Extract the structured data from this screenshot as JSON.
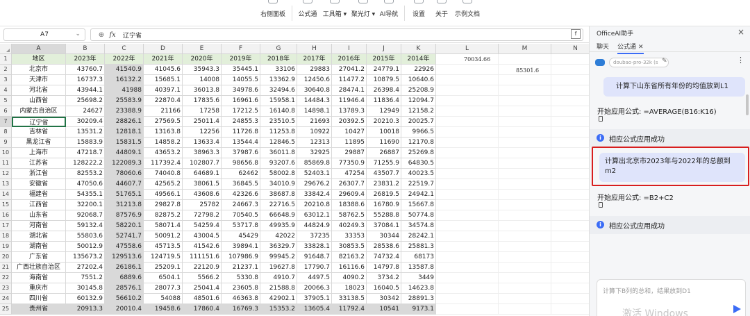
{
  "ribbon": {
    "groups": [
      {
        "label": "右侧面板"
      },
      {
        "label": "公式通"
      },
      {
        "label": "工具箱 ▾"
      },
      {
        "label": "聚光灯 ▾"
      },
      {
        "label": "AI导航"
      },
      {
        "label": "设置"
      },
      {
        "label": "关于"
      },
      {
        "label": "示例文档"
      }
    ]
  },
  "formula_bar": {
    "name_box": "A7",
    "zoom_icon": "zoom-icon",
    "fx_label": "fx",
    "content": "辽宁省"
  },
  "sheet": {
    "columns": [
      "A",
      "B",
      "C",
      "D",
      "E",
      "F",
      "G",
      "H",
      "I",
      "J",
      "K",
      "L",
      "M",
      "N"
    ],
    "header_row": [
      "地区",
      "2023年",
      "2022年",
      "2021年",
      "2020年",
      "2019年",
      "2018年",
      "2017年",
      "2016年",
      "2015年",
      "2014年"
    ],
    "rows": [
      [
        "北京市",
        "43760.7",
        "41540.9",
        "41045.6",
        "35943.3",
        "35445.1",
        "33106",
        "29883",
        "27041.2",
        "24779.1",
        "22926"
      ],
      [
        "天津市",
        "16737.3",
        "16132.2",
        "15685.1",
        "14008",
        "14055.5",
        "13362.9",
        "12450.6",
        "11477.2",
        "10879.5",
        "10640.6"
      ],
      [
        "河北省",
        "43944.1",
        "41988",
        "40397.1",
        "36013.8",
        "34978.6",
        "32494.6",
        "30640.8",
        "28474.1",
        "26398.4",
        "25208.9"
      ],
      [
        "山西省",
        "25698.2",
        "25583.9",
        "22870.4",
        "17835.6",
        "16961.6",
        "15958.1",
        "14484.3",
        "11946.4",
        "11836.4",
        "12094.7"
      ],
      [
        "内蒙古自治区",
        "24627",
        "23388.9",
        "21166",
        "17258",
        "17212.5",
        "16140.8",
        "14898.1",
        "13789.3",
        "12949",
        "12158.2"
      ],
      [
        "辽宁省",
        "30209.4",
        "28826.1",
        "27569.5",
        "25011.4",
        "24855.3",
        "23510.5",
        "21693",
        "20392.5",
        "20210.3",
        "20025.7"
      ],
      [
        "吉林省",
        "13531.2",
        "12818.1",
        "13163.8",
        "12256",
        "11726.8",
        "11253.8",
        "10922",
        "10427",
        "10018",
        "9966.5"
      ],
      [
        "黑龙江省",
        "15883.9",
        "15831.5",
        "14858.2",
        "13633.4",
        "13544.4",
        "12846.5",
        "12313",
        "11895",
        "11690",
        "12170.8"
      ],
      [
        "上海市",
        "47218.7",
        "44809.1",
        "43653.2",
        "38963.3",
        "37987.6",
        "36011.8",
        "32925",
        "29887",
        "26887",
        "25269.8"
      ],
      [
        "江苏省",
        "128222.2",
        "122089.3",
        "117392.4",
        "102807.7",
        "98656.8",
        "93207.6",
        "85869.8",
        "77350.9",
        "71255.9",
        "64830.5"
      ],
      [
        "浙江省",
        "82553.2",
        "78060.6",
        "74040.8",
        "64689.1",
        "62462",
        "58002.8",
        "52403.1",
        "47254",
        "43507.7",
        "40023.5"
      ],
      [
        "安徽省",
        "47050.6",
        "44607.7",
        "42565.2",
        "38061.5",
        "36845.5",
        "34010.9",
        "29676.2",
        "26307.7",
        "23831.2",
        "22519.7"
      ],
      [
        "福建省",
        "54355.1",
        "51765.1",
        "49566.1",
        "43608.6",
        "42326.6",
        "38687.8",
        "33842.4",
        "29609.4",
        "26819.5",
        "24942.1"
      ],
      [
        "江西省",
        "32200.1",
        "31213.8",
        "29827.8",
        "25782",
        "24667.3",
        "22716.5",
        "20210.8",
        "18388.6",
        "16780.9",
        "15667.8"
      ],
      [
        "山东省",
        "92068.7",
        "87576.9",
        "82875.2",
        "72798.2",
        "70540.5",
        "66648.9",
        "63012.1",
        "58762.5",
        "55288.8",
        "50774.8"
      ],
      [
        "河南省",
        "59132.4",
        "58220.1",
        "58071.4",
        "54259.4",
        "53717.8",
        "49935.9",
        "44824.9",
        "40249.3",
        "37084.1",
        "34574.8"
      ],
      [
        "湖北省",
        "55803.6",
        "52741.7",
        "50091.2",
        "43004.5",
        "45429",
        "42022",
        "37235",
        "33353",
        "30344",
        "28242.1"
      ],
      [
        "湖南省",
        "50012.9",
        "47558.6",
        "45713.5",
        "41542.6",
        "39894.1",
        "36329.7",
        "33828.1",
        "30853.5",
        "28538.6",
        "25881.3"
      ],
      [
        "广东省",
        "135673.2",
        "129513.6",
        "124719.5",
        "111151.6",
        "107986.9",
        "99945.2",
        "91648.7",
        "82163.2",
        "74732.4",
        "68173"
      ],
      [
        "广西壮族自治区",
        "27202.4",
        "26186.1",
        "25209.1",
        "22120.9",
        "21237.1",
        "19627.8",
        "17790.7",
        "16116.6",
        "14797.8",
        "13587.8"
      ],
      [
        "海南省",
        "7551.2",
        "6889.6",
        "6504.1",
        "5566.2",
        "5330.8",
        "4910.7",
        "4497.5",
        "4090.2",
        "3734.2",
        "3449"
      ],
      [
        "重庆市",
        "30145.8",
        "28576.1",
        "28077.3",
        "25041.4",
        "23605.8",
        "21588.8",
        "20066.3",
        "18023",
        "16040.5",
        "14623.8"
      ],
      [
        "四川省",
        "60132.9",
        "56610.2",
        "54088",
        "48501.6",
        "46363.8",
        "42902.1",
        "37905.1",
        "33138.5",
        "30342",
        "28891.3"
      ],
      [
        "贵州省",
        "20913.3",
        "20010.4",
        "19458.6",
        "17860.4",
        "16769.3",
        "15353.2",
        "13605.4",
        "11792.4",
        "10541",
        "9173.1"
      ]
    ],
    "l1_value": "70034.66",
    "m2_value": "85301.6"
  },
  "panel": {
    "title": "OfficeAI助手",
    "tabs": [
      "聊天",
      "公式通"
    ],
    "model": "doubao-pro-32k (s",
    "messages": [
      {
        "type": "user",
        "text": "计算下山东省所有年份的均值放到L1"
      },
      {
        "type": "ai",
        "text": "开始应用公式: =AVERAGE(B16:K16)"
      },
      {
        "type": "success",
        "text": "相应公式应用成功"
      },
      {
        "type": "user",
        "text": "计算出北京市2023年与2022年的总额到m2"
      },
      {
        "type": "ai",
        "text": "开始应用公式: =B2+C2"
      },
      {
        "type": "success",
        "text": "相应公式应用成功"
      }
    ],
    "input_placeholder": "计算下B列的总和，结果放到D1",
    "watermark": "激活 Windows"
  },
  "colors": {
    "header_fill": "#e2efda",
    "selection": "#217346",
    "accent": "#3b6cf6",
    "highlight_border": "#d81e1e"
  }
}
